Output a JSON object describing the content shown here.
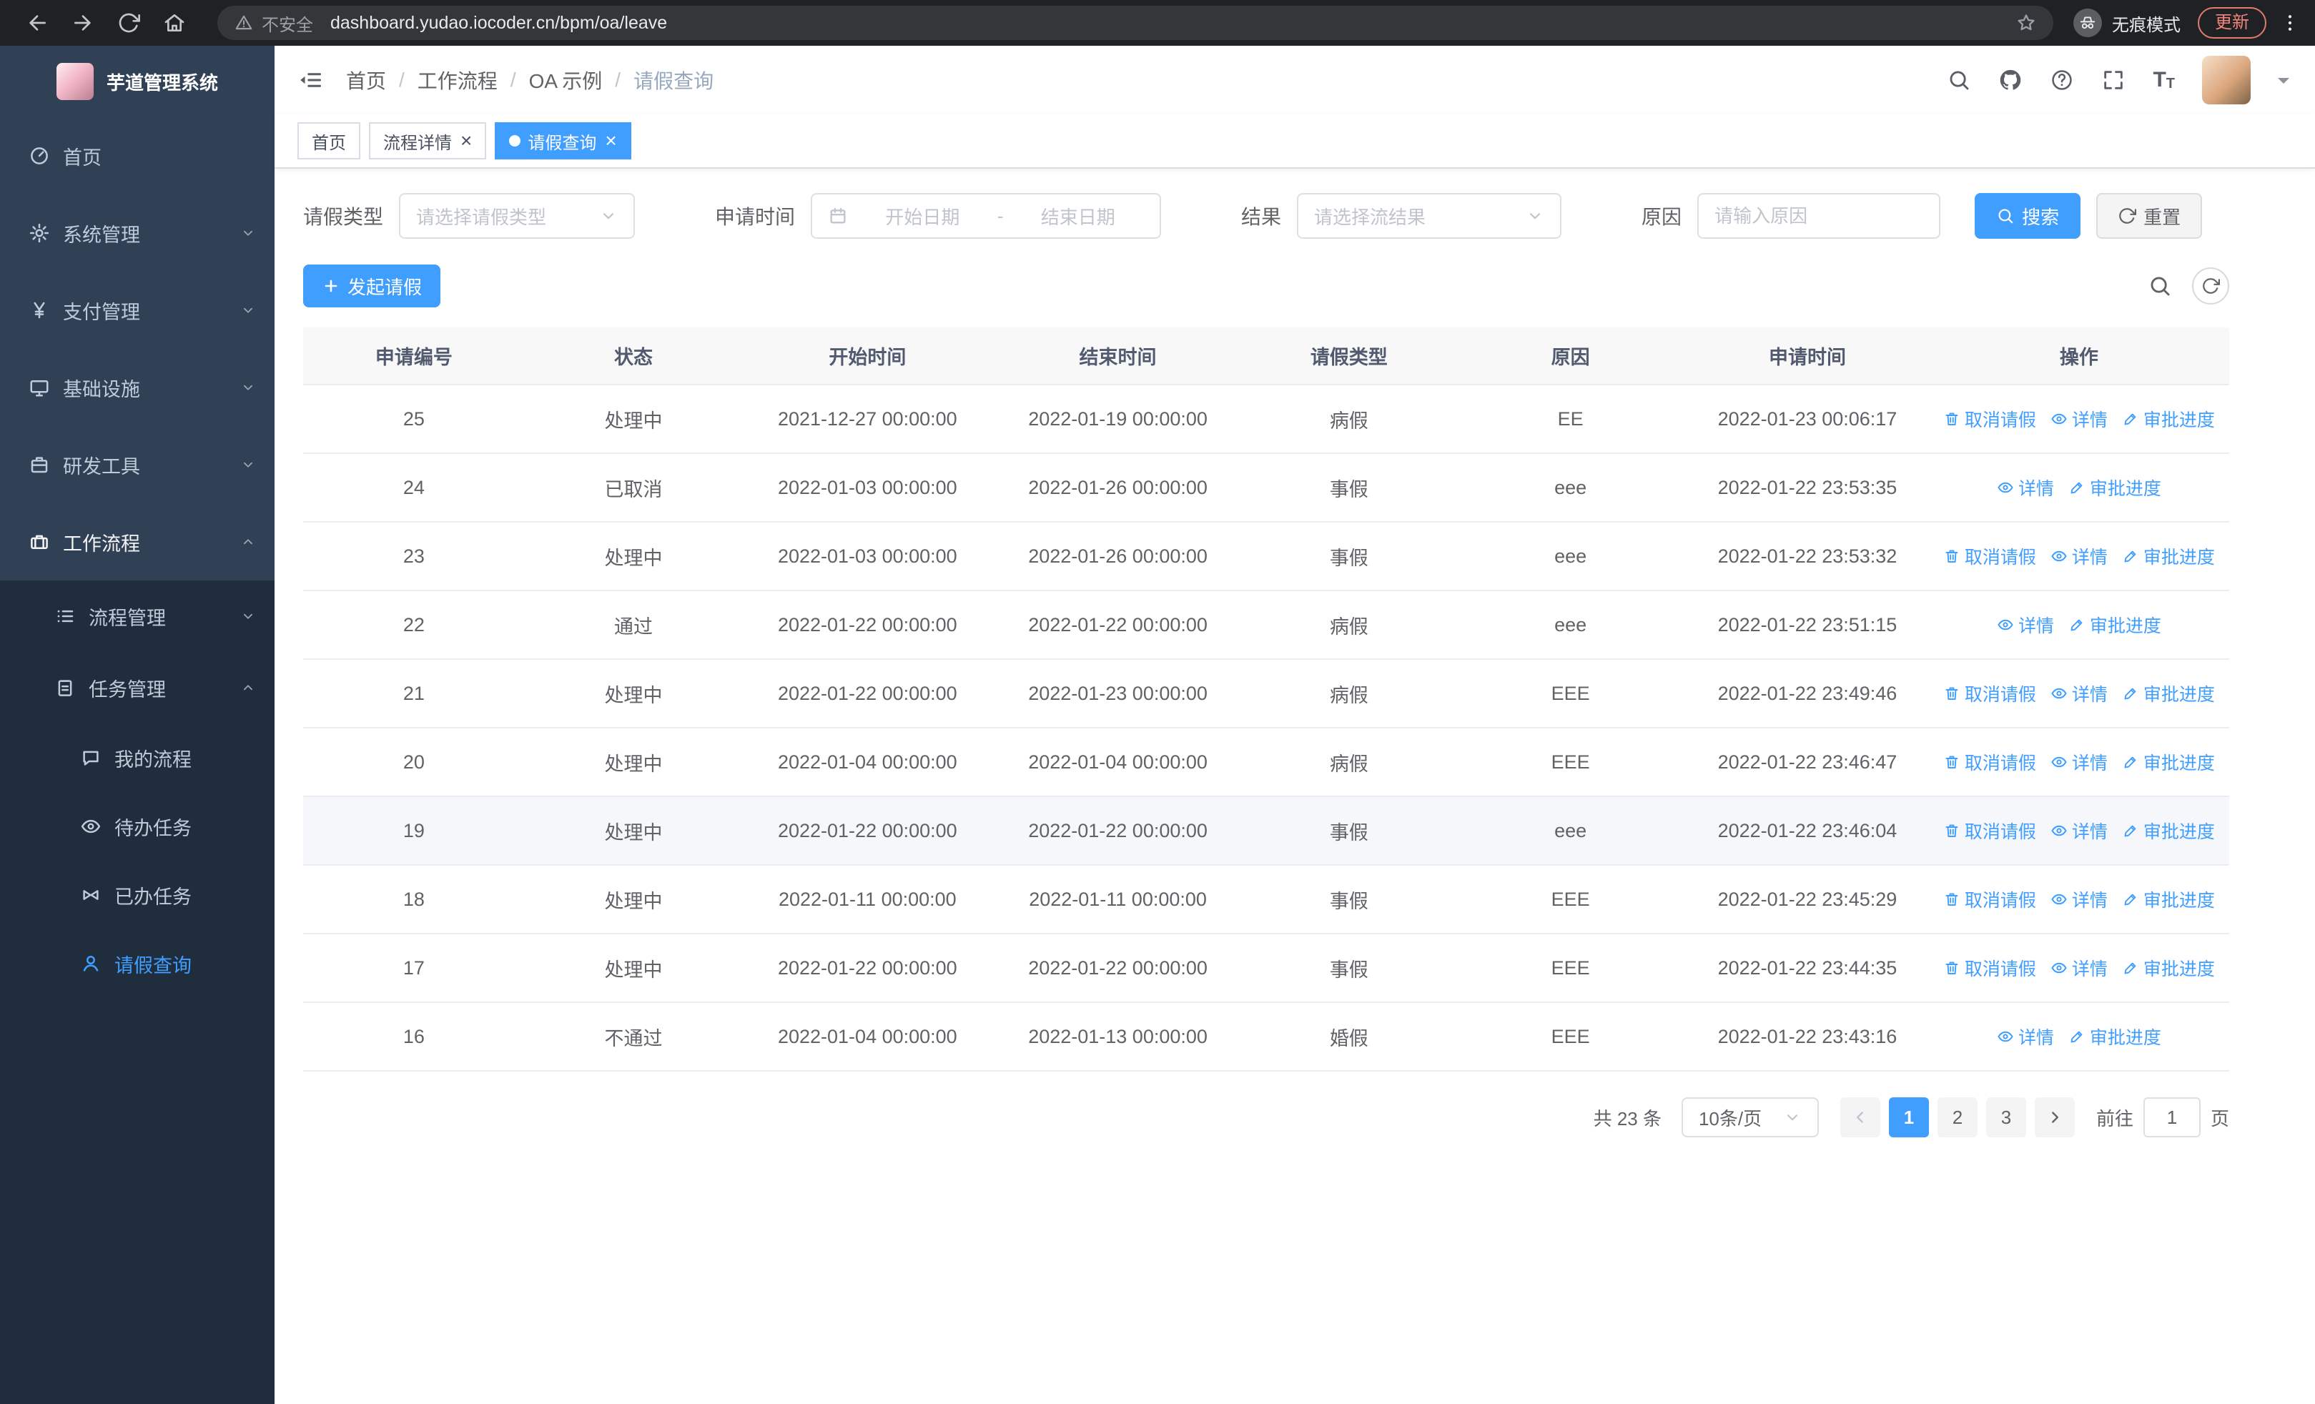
{
  "browser": {
    "security_label": "不安全",
    "url": "dashboard.yudao.iocoder.cn/bpm/oa/leave",
    "incognito_label": "无痕模式",
    "update_label": "更新"
  },
  "sidebar": {
    "title": "芋道管理系统",
    "menu": [
      {
        "key": "home",
        "icon": "dashboard",
        "label": "首页"
      },
      {
        "key": "system",
        "icon": "gear",
        "label": "系统管理",
        "expandable": true
      },
      {
        "key": "payment",
        "icon": "yen",
        "label": "支付管理",
        "expandable": true
      },
      {
        "key": "infrastructure",
        "icon": "monitor",
        "label": "基础设施",
        "expandable": true
      },
      {
        "key": "devtools",
        "icon": "toolbox",
        "label": "研发工具",
        "expandable": true
      },
      {
        "key": "workflow",
        "icon": "suitcase",
        "label": "工作流程",
        "expandable": true,
        "expanded": true,
        "children": [
          {
            "key": "process-management",
            "icon": "list",
            "label": "流程管理",
            "expandable": true
          },
          {
            "key": "task-management",
            "icon": "clipboard",
            "label": "任务管理",
            "expandable": true,
            "expanded": true,
            "children": [
              {
                "key": "my-process",
                "icon": "chat",
                "label": "我的流程"
              },
              {
                "key": "todo-task",
                "icon": "eye",
                "label": "待办任务"
              },
              {
                "key": "done-task",
                "icon": "bowtie",
                "label": "已办任务"
              },
              {
                "key": "leave-query",
                "icon": "user",
                "label": "请假查询",
                "active": true
              }
            ]
          }
        ]
      }
    ]
  },
  "header": {
    "breadcrumb": [
      "首页",
      "工作流程",
      "OA 示例",
      "请假查询"
    ]
  },
  "tabs": [
    {
      "key": "home",
      "label": "首页",
      "active": false,
      "closable": false
    },
    {
      "key": "process-detail",
      "label": "流程详情",
      "active": false,
      "closable": true
    },
    {
      "key": "leave-query",
      "label": "请假查询",
      "active": true,
      "closable": true
    }
  ],
  "filters": {
    "type_label": "请假类型",
    "type_placeholder": "请选择请假类型",
    "time_label": "申请时间",
    "start_placeholder": "开始日期",
    "range_separator": "-",
    "end_placeholder": "结束日期",
    "result_label": "结果",
    "result_placeholder": "请选择流结果",
    "reason_label": "原因",
    "reason_placeholder": "请输入原因",
    "search_label": "搜索",
    "reset_label": "重置"
  },
  "toolbar": {
    "create_label": "发起请假"
  },
  "table": {
    "columns": [
      "申请编号",
      "状态",
      "开始时间",
      "结束时间",
      "请假类型",
      "原因",
      "申请时间",
      "操作"
    ],
    "col_keys": [
      "id",
      "status",
      "start",
      "end",
      "type",
      "reason",
      "applied"
    ],
    "action_labels": {
      "cancel": "取消请假",
      "detail": "详情",
      "progress": "审批进度"
    },
    "rows": [
      {
        "id": "25",
        "status": "处理中",
        "start": "2021-12-27 00:00:00",
        "end": "2022-01-19 00:00:00",
        "type": "病假",
        "reason": "EE",
        "applied": "2022-01-23 00:06:17",
        "actions": [
          "cancel",
          "detail",
          "progress"
        ]
      },
      {
        "id": "24",
        "status": "已取消",
        "start": "2022-01-03 00:00:00",
        "end": "2022-01-26 00:00:00",
        "type": "事假",
        "reason": "eee",
        "applied": "2022-01-22 23:53:35",
        "actions": [
          "detail",
          "progress"
        ]
      },
      {
        "id": "23",
        "status": "处理中",
        "start": "2022-01-03 00:00:00",
        "end": "2022-01-26 00:00:00",
        "type": "事假",
        "reason": "eee",
        "applied": "2022-01-22 23:53:32",
        "actions": [
          "cancel",
          "detail",
          "progress"
        ]
      },
      {
        "id": "22",
        "status": "通过",
        "start": "2022-01-22 00:00:00",
        "end": "2022-01-22 00:00:00",
        "type": "病假",
        "reason": "eee",
        "applied": "2022-01-22 23:51:15",
        "actions": [
          "detail",
          "progress"
        ]
      },
      {
        "id": "21",
        "status": "处理中",
        "start": "2022-01-22 00:00:00",
        "end": "2022-01-23 00:00:00",
        "type": "病假",
        "reason": "EEE",
        "applied": "2022-01-22 23:49:46",
        "actions": [
          "cancel",
          "detail",
          "progress"
        ]
      },
      {
        "id": "20",
        "status": "处理中",
        "start": "2022-01-04 00:00:00",
        "end": "2022-01-04 00:00:00",
        "type": "病假",
        "reason": "EEE",
        "applied": "2022-01-22 23:46:47",
        "actions": [
          "cancel",
          "detail",
          "progress"
        ]
      },
      {
        "id": "19",
        "status": "处理中",
        "start": "2022-01-22 00:00:00",
        "end": "2022-01-22 00:00:00",
        "type": "事假",
        "reason": "eee",
        "applied": "2022-01-22 23:46:04",
        "actions": [
          "cancel",
          "detail",
          "progress"
        ],
        "highlight": true
      },
      {
        "id": "18",
        "status": "处理中",
        "start": "2022-01-11 00:00:00",
        "end": "2022-01-11 00:00:00",
        "type": "事假",
        "reason": "EEE",
        "applied": "2022-01-22 23:45:29",
        "actions": [
          "cancel",
          "detail",
          "progress"
        ]
      },
      {
        "id": "17",
        "status": "处理中",
        "start": "2022-01-22 00:00:00",
        "end": "2022-01-22 00:00:00",
        "type": "事假",
        "reason": "EEE",
        "applied": "2022-01-22 23:44:35",
        "actions": [
          "cancel",
          "detail",
          "progress"
        ]
      },
      {
        "id": "16",
        "status": "不通过",
        "start": "2022-01-04 00:00:00",
        "end": "2022-01-13 00:00:00",
        "type": "婚假",
        "reason": "EEE",
        "applied": "2022-01-22 23:43:16",
        "actions": [
          "detail",
          "progress"
        ]
      }
    ]
  },
  "pagination": {
    "total_label": "共 23 条",
    "page_size": "10条/页",
    "pages": [
      "1",
      "2",
      "3"
    ],
    "active_page": "1",
    "goto_label": "前往",
    "goto_value": "1",
    "goto_suffix": "页"
  },
  "colors": {
    "primary": "#409eff",
    "sidebar_bg": "#304156",
    "sidebar_sub_bg": "#1f2d3d",
    "chrome_bg": "#202124",
    "update_accent": "#f08579"
  }
}
